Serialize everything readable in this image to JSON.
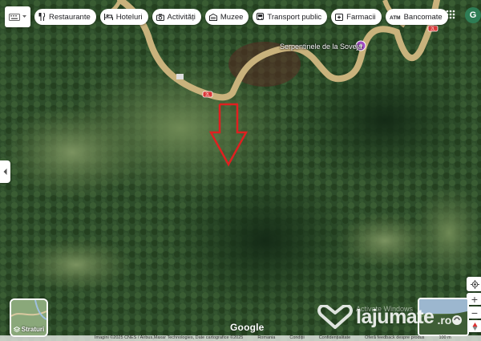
{
  "topbar": {
    "chips": [
      {
        "label": "Restaurante",
        "icon": "fork-knife-icon"
      },
      {
        "label": "Hoteluri",
        "icon": "bed-icon"
      },
      {
        "label": "Activități",
        "icon": "camera-icon"
      },
      {
        "label": "Muzee",
        "icon": "museum-icon"
      },
      {
        "label": "Transport public",
        "icon": "bus-icon"
      },
      {
        "label": "Farmacii",
        "icon": "pill-icon"
      },
      {
        "label": "Bancomate",
        "icon": "atm-icon"
      }
    ],
    "avatar_initial": "G"
  },
  "map": {
    "poi_label": "Serpentinele de la Soveja",
    "road_shields": [
      "2L",
      "2L",
      "2L"
    ],
    "marker": "red-arrow-down",
    "colors": {
      "road": "#c9b27c",
      "marker": "#e02020",
      "forest": "#274424"
    }
  },
  "layers": {
    "label": "Straturi"
  },
  "branding": {
    "google": "Google",
    "watermark_brand": "lajumate",
    "watermark_tld": ".ro",
    "os_notice": "Activate Windows"
  },
  "footer": {
    "items": [
      "Imagini ©2025 CNES / Airbus,Maxar Technologies, Date cartografice ©2025",
      "Romania",
      "Condiții",
      "Confidențialitate",
      "Oferă feedback despre produs",
      "100 m"
    ]
  }
}
